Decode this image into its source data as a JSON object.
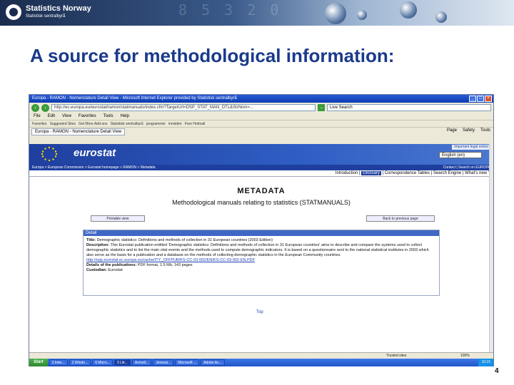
{
  "header": {
    "brand_name": "Statistics Norway",
    "brand_sub": "Statistisk sentralbyrå",
    "decor_digits": "8 5 3 2 0"
  },
  "slide": {
    "title": "A source for methodological information:",
    "page_number": "4"
  },
  "browser": {
    "window_title": "Europa - RAMON - Nomenclature Detail View - Microsoft Internet Explorer provided by Statistisk sentralbyrå",
    "address": "http://ec.europa.eu/eurostat/ramon/statmanuals/index.cfm?TargetUrl=DSP_STAT_MAN_DTL&StrNom=...",
    "search_value": "Live Search",
    "menu": [
      "File",
      "Edit",
      "View",
      "Favorites",
      "Tools",
      "Help"
    ],
    "links": [
      "Favorites",
      "Suggested Sites",
      "Get More Add-ons",
      "Statistisk sentralbyrå",
      "programmer",
      "innsiden",
      "Free Hotmail"
    ],
    "tab_label": "Europa - RAMON - Nomenclature Detail View",
    "tab_tools": [
      "Page",
      "Safety",
      "Tools"
    ]
  },
  "eurostat": {
    "logo": "eurostat",
    "important_label": "Important legal notice",
    "language": "English (en)",
    "breadcrumb": "Europa > European Commission > Eurostat homepage > RAMON > Metadata",
    "breadcrumb_right": "Contact | Search on EUROPA",
    "subnav": [
      "Introduction",
      "Glossary",
      "Correspondence Tables",
      "Search Engine",
      "What's new ?"
    ],
    "subnav_active": "Glossary"
  },
  "metadata": {
    "heading": "METADATA",
    "subheading": "Methodological manuals relating to statistics (STATMANUALS)",
    "print_button": "Printable view",
    "back_button": "Back to previous page",
    "detail_header": "Detail",
    "title_label": "Title:",
    "title_value": "Demographic statistics: Definitions and methods of collection in 31 European countries (2003 Edition)",
    "description_label": "Description:",
    "description_value": "This Eurostat publication entitled 'Demographic statistics: Definitions and methods of collection in 31 European countries' aims to describe and compare the systems used to collect demographic statistics and to list the main vital events and the methods used to compute demographic indicators. It is based on a questionnaire sent to the national statistical institutes in 2003 which also serve as the basis for a publication and a database on the methods of collecting demographic statistics in the European Community countries.",
    "url": "http://epp.eurostat.ec.europa.eu/cache/ITY_OFFPUB/KS-CC-03-002/EN/KS-CC-03-002-EN.PDF",
    "details_label": "Details of the publications:",
    "details_value": "PDF format, 1.5 Mb, 143 pages",
    "custodian_label": "Custodian:",
    "custodian_value": "Eurostat",
    "top_link": "Top"
  },
  "status": {
    "zone": "Trusted sites",
    "zoom": "100%"
  },
  "taskbar": {
    "start": "Start",
    "items": [
      "3 Inter...",
      "2 Windo...",
      "6 Micro...",
      "3 Litr...",
      "Avmelt...",
      "Jenessi...",
      "Microsoft ...",
      "Adobe Ac..."
    ],
    "active_index": 3,
    "clock": "10:15"
  },
  "colors": {
    "title_blue": "#1a3a8a",
    "eurostat_blue": "#1f3f9f",
    "xp_blue": "#2a5bd7"
  },
  "icons": [
    "close-icon",
    "back-icon",
    "forward-icon",
    "go-icon",
    "eu-flag-icon"
  ]
}
